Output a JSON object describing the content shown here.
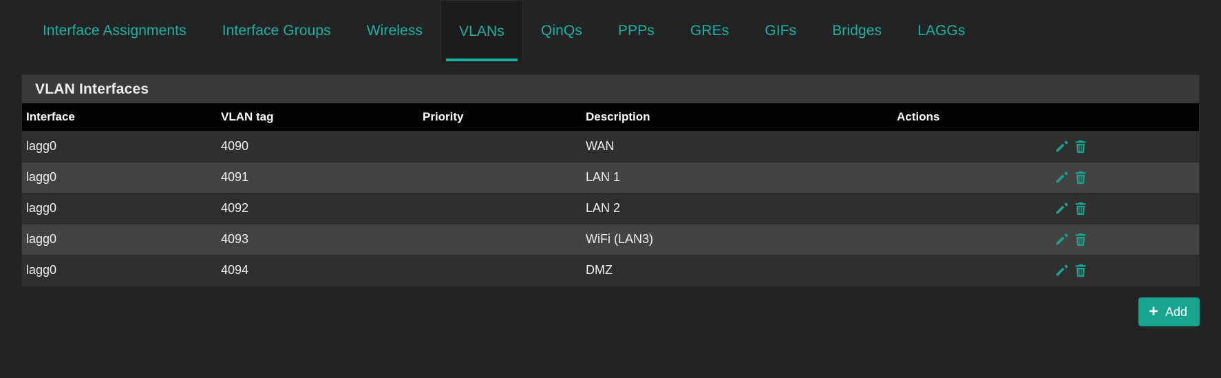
{
  "colors": {
    "accent": "#17a58f",
    "tab_text": "#19b3a6",
    "page_bg": "#232323",
    "panel_heading_bg": "#3a3a3a",
    "table_header_bg": "#030303",
    "row_even_bg": "#2f2f2f",
    "row_odd_bg": "#434343",
    "icon_teal": "#17a58f"
  },
  "tabs": [
    {
      "label": "Interface Assignments",
      "active": false
    },
    {
      "label": "Interface Groups",
      "active": false
    },
    {
      "label": "Wireless",
      "active": false
    },
    {
      "label": "VLANs",
      "active": true
    },
    {
      "label": "QinQs",
      "active": false
    },
    {
      "label": "PPPs",
      "active": false
    },
    {
      "label": "GREs",
      "active": false
    },
    {
      "label": "GIFs",
      "active": false
    },
    {
      "label": "Bridges",
      "active": false
    },
    {
      "label": "LAGGs",
      "active": false
    }
  ],
  "panel": {
    "title": "VLAN Interfaces",
    "columns": [
      "Interface",
      "VLAN tag",
      "Priority",
      "Description",
      "Actions"
    ],
    "rows": [
      {
        "interface": "lagg0",
        "vlan_tag": "4090",
        "priority": "",
        "description": "WAN"
      },
      {
        "interface": "lagg0",
        "vlan_tag": "4091",
        "priority": "",
        "description": "LAN 1"
      },
      {
        "interface": "lagg0",
        "vlan_tag": "4092",
        "priority": "",
        "description": "LAN 2"
      },
      {
        "interface": "lagg0",
        "vlan_tag": "4093",
        "priority": "",
        "description": "WiFi (LAN3)"
      },
      {
        "interface": "lagg0",
        "vlan_tag": "4094",
        "priority": "",
        "description": "DMZ"
      }
    ],
    "row_actions": [
      {
        "name": "edit-icon",
        "title": "Edit"
      },
      {
        "name": "delete-icon",
        "title": "Delete"
      }
    ]
  },
  "footer": {
    "add_label": "Add",
    "add_icon": "plus-icon",
    "plus_glyph": "+"
  }
}
